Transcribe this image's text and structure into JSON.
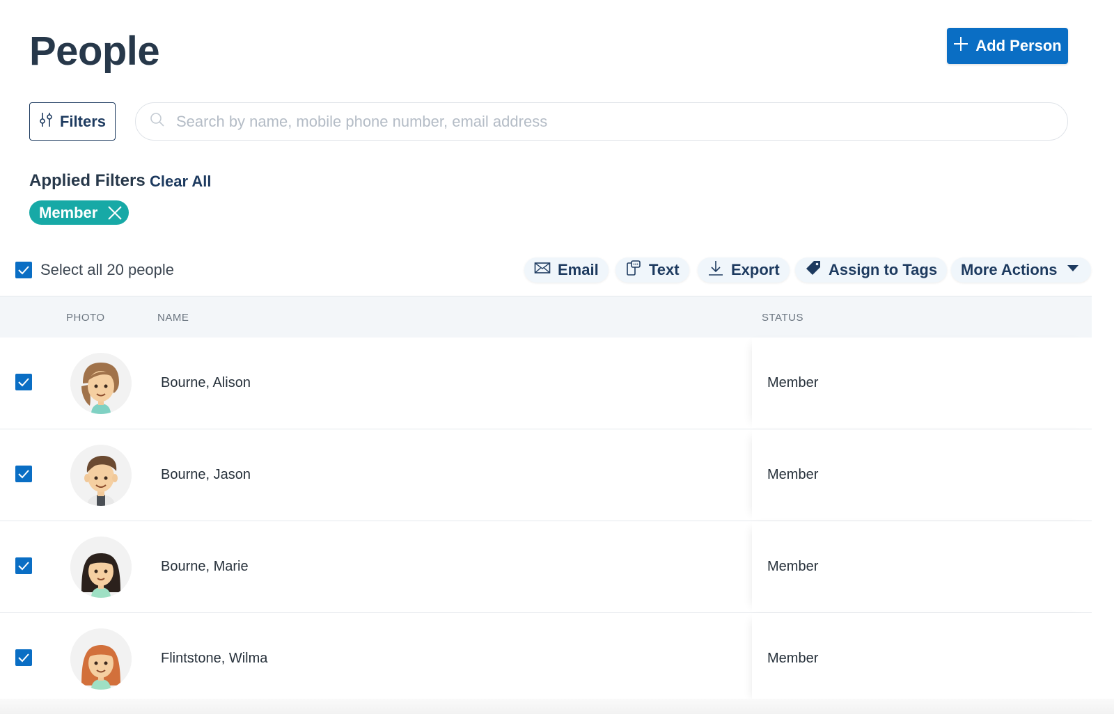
{
  "page_title": "People",
  "add_button_label": "Add Person",
  "filters_button_label": "Filters",
  "search": {
    "placeholder": "Search by name, mobile phone number, email address",
    "value": ""
  },
  "applied_filters": {
    "label": "Applied Filters",
    "clear_all_label": "Clear All",
    "chips": [
      "Member"
    ]
  },
  "selection": {
    "label": "Select all 20 people",
    "checked": true
  },
  "actions": {
    "email": "Email",
    "text": "Text",
    "export": "Export",
    "assign_tags": "Assign to Tags",
    "more": "More Actions"
  },
  "table": {
    "headers": {
      "photo": "PHOTO",
      "name": "NAME",
      "status": "STATUS"
    },
    "rows": [
      {
        "name": "Bourne, Alison",
        "status": "Member",
        "checked": true,
        "avatar": "woman-brown-hair-avatar"
      },
      {
        "name": "Bourne, Jason",
        "status": "Member",
        "checked": true,
        "avatar": "man-brown-hair-avatar"
      },
      {
        "name": "Bourne, Marie",
        "status": "Member",
        "checked": true,
        "avatar": "girl-black-hair-avatar"
      },
      {
        "name": "Flintstone, Wilma",
        "status": "Member",
        "checked": true,
        "avatar": "woman-red-hair-avatar"
      }
    ]
  },
  "colors": {
    "primary": "#0a6ec4",
    "navy": "#1d3a5f",
    "chip": "#17a9a6",
    "header_bg": "#f3f6f9"
  }
}
